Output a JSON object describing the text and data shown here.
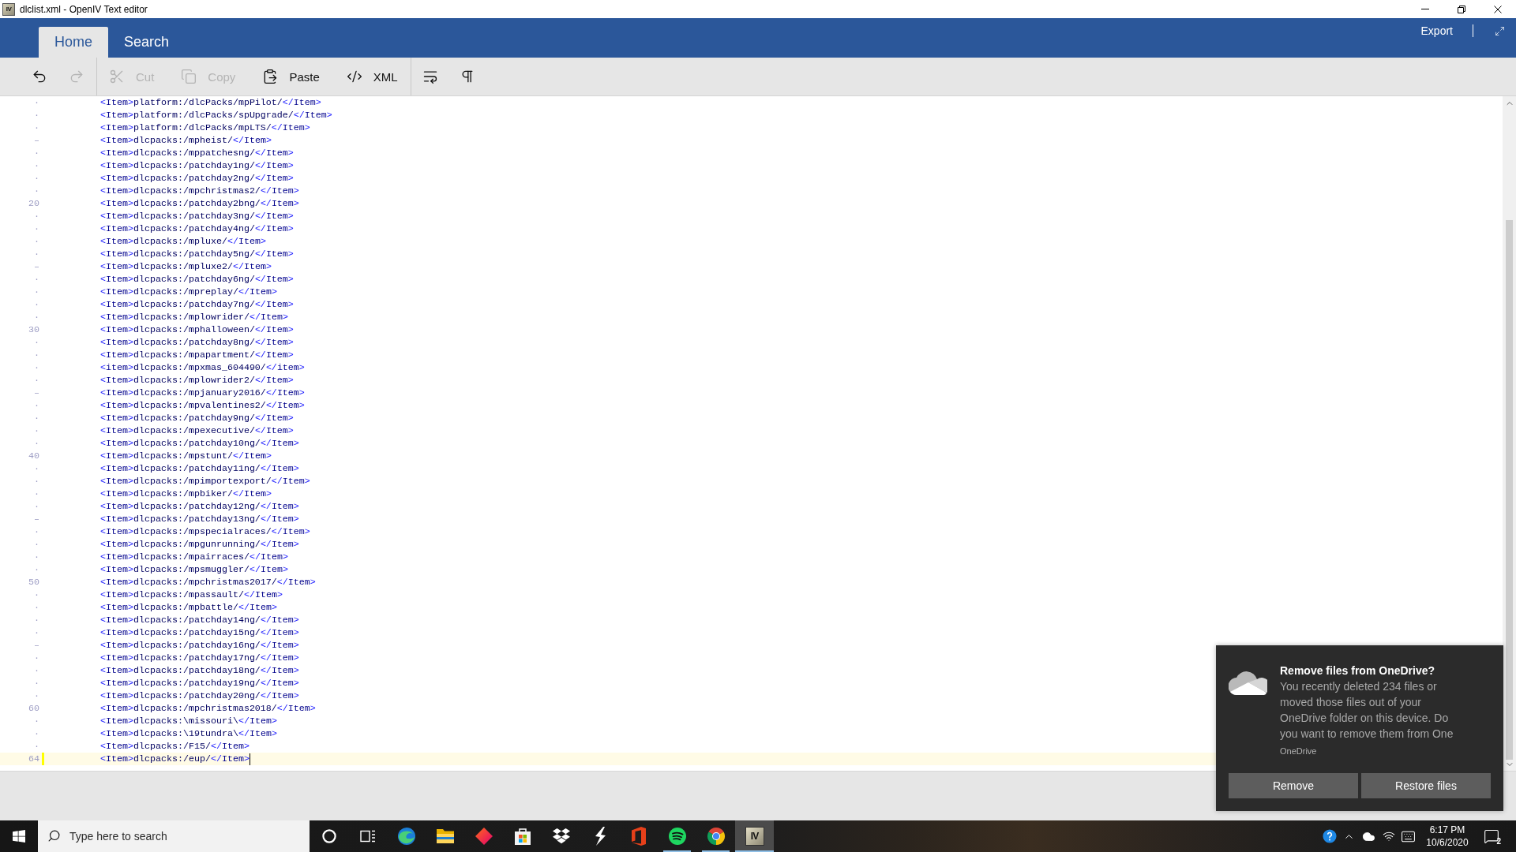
{
  "window": {
    "icon_text": "IV",
    "title": "dlclist.xml - OpenIV Text editor"
  },
  "ribbon": {
    "tabs": [
      {
        "label": "Home",
        "selected": true
      },
      {
        "label": "Search",
        "selected": false
      }
    ],
    "actions": [
      "Export"
    ]
  },
  "toolbar": {
    "groups": [
      [
        {
          "kind": "undo",
          "disabled": false
        },
        {
          "kind": "redo",
          "disabled": true
        }
      ],
      [
        {
          "kind": "cut",
          "label": "Cut",
          "disabled": true
        },
        {
          "kind": "copy",
          "label": "Copy",
          "disabled": true
        },
        {
          "kind": "paste",
          "label": "Paste",
          "disabled": false
        },
        {
          "kind": "xml",
          "label": "XML",
          "disabled": false
        }
      ],
      [
        {
          "kind": "wrap",
          "disabled": false
        },
        {
          "kind": "pilcrow",
          "disabled": false
        }
      ]
    ]
  },
  "editor": {
    "lines": [
      {
        "number": "·",
        "current": false,
        "code": "<Item>platform:/dlcPacks/mpPilot/</Item>"
      },
      {
        "number": "·",
        "current": false,
        "code": "<Item>platform:/dlcPacks/spUpgrade/</Item>"
      },
      {
        "number": "·",
        "current": false,
        "code": "<Item>platform:/dlcPacks/mpLTS/</Item>"
      },
      {
        "number": "–",
        "current": false,
        "code": "<Item>dlcpacks:/mpheist/</Item>"
      },
      {
        "number": "·",
        "current": false,
        "code": "<Item>dlcpacks:/mppatchesng/</Item>"
      },
      {
        "number": "·",
        "current": false,
        "code": "<Item>dlcpacks:/patchday1ng/</Item>"
      },
      {
        "number": "·",
        "current": false,
        "code": "<Item>dlcpacks:/patchday2ng/</Item>"
      },
      {
        "number": "·",
        "current": false,
        "code": "<Item>dlcpacks:/mpchristmas2/</Item>"
      },
      {
        "number": "20",
        "current": false,
        "code": "<Item>dlcpacks:/patchday2bng/</Item>"
      },
      {
        "number": "·",
        "current": false,
        "code": "<Item>dlcpacks:/patchday3ng/</Item>"
      },
      {
        "number": "·",
        "current": false,
        "code": "<Item>dlcpacks:/patchday4ng/</Item>"
      },
      {
        "number": "·",
        "current": false,
        "code": "<Item>dlcpacks:/mpluxe/</Item>"
      },
      {
        "number": "·",
        "current": false,
        "code": "<Item>dlcpacks:/patchday5ng/</Item>"
      },
      {
        "number": "–",
        "current": false,
        "code": "<Item>dlcpacks:/mpluxe2/</Item>"
      },
      {
        "number": "·",
        "current": false,
        "code": "<Item>dlcpacks:/patchday6ng/</Item>"
      },
      {
        "number": "·",
        "current": false,
        "code": "<Item>dlcpacks:/mpreplay/</Item>"
      },
      {
        "number": "·",
        "current": false,
        "code": "<Item>dlcpacks:/patchday7ng/</Item>"
      },
      {
        "number": "·",
        "current": false,
        "code": "<Item>dlcpacks:/mplowrider/</Item>"
      },
      {
        "number": "30",
        "current": false,
        "code": "<Item>dlcpacks:/mphalloween/</Item>"
      },
      {
        "number": "·",
        "current": false,
        "code": "<Item>dlcpacks:/patchday8ng/</Item>"
      },
      {
        "number": "·",
        "current": false,
        "code": "<Item>dlcpacks:/mpapartment/</Item>"
      },
      {
        "number": "·",
        "current": false,
        "code": "<item>dlcpacks:/mpxmas_604490/</item>"
      },
      {
        "number": "·",
        "current": false,
        "code": "<Item>dlcpacks:/mplowrider2/</Item>"
      },
      {
        "number": "–",
        "current": false,
        "code": "<Item>dlcpacks:/mpjanuary2016/</Item>"
      },
      {
        "number": "·",
        "current": false,
        "code": "<Item>dlcpacks:/mpvalentines2/</Item>"
      },
      {
        "number": "·",
        "current": false,
        "code": "<Item>dlcpacks:/patchday9ng/</Item>"
      },
      {
        "number": "·",
        "current": false,
        "code": "<Item>dlcpacks:/mpexecutive/</Item>"
      },
      {
        "number": "·",
        "current": false,
        "code": "<Item>dlcpacks:/patchday10ng/</Item>"
      },
      {
        "number": "40",
        "current": false,
        "code": "<Item>dlcpacks:/mpstunt/</Item>"
      },
      {
        "number": "·",
        "current": false,
        "code": "<Item>dlcpacks:/patchday11ng/</Item>"
      },
      {
        "number": "·",
        "current": false,
        "code": "<Item>dlcpacks:/mpimportexport/</Item>"
      },
      {
        "number": "·",
        "current": false,
        "code": "<Item>dlcpacks:/mpbiker/</Item>"
      },
      {
        "number": "·",
        "current": false,
        "code": "<Item>dlcpacks:/patchday12ng/</Item>"
      },
      {
        "number": "–",
        "current": false,
        "code": "<Item>dlcpacks:/patchday13ng/</Item>"
      },
      {
        "number": "·",
        "current": false,
        "code": "<Item>dlcpacks:/mpspecialraces/</Item>"
      },
      {
        "number": "·",
        "current": false,
        "code": "<Item>dlcpacks:/mpgunrunning/</Item>"
      },
      {
        "number": "·",
        "current": false,
        "code": "<Item>dlcpacks:/mpairraces/</Item>"
      },
      {
        "number": "·",
        "current": false,
        "code": "<Item>dlcpacks:/mpsmuggler/</Item>"
      },
      {
        "number": "50",
        "current": false,
        "code": "<Item>dlcpacks:/mpchristmas2017/</Item>"
      },
      {
        "number": "·",
        "current": false,
        "code": "<Item>dlcpacks:/mpassault/</Item>"
      },
      {
        "number": "·",
        "current": false,
        "code": "<Item>dlcpacks:/mpbattle/</Item>"
      },
      {
        "number": "·",
        "current": false,
        "code": "<Item>dlcpacks:/patchday14ng/</Item>"
      },
      {
        "number": "·",
        "current": false,
        "code": "<Item>dlcpacks:/patchday15ng/</Item>"
      },
      {
        "number": "–",
        "current": false,
        "code": "<Item>dlcpacks:/patchday16ng/</Item>"
      },
      {
        "number": "·",
        "current": false,
        "code": "<Item>dlcpacks:/patchday17ng/</Item>"
      },
      {
        "number": "·",
        "current": false,
        "code": "<Item>dlcpacks:/patchday18ng/</Item>"
      },
      {
        "number": "·",
        "current": false,
        "code": "<Item>dlcpacks:/patchday19ng/</Item>"
      },
      {
        "number": "·",
        "current": false,
        "code": "<Item>dlcpacks:/patchday20ng/</Item>"
      },
      {
        "number": "60",
        "current": false,
        "code": "<Item>dlcpacks:/mpchristmas2018/</Item>"
      },
      {
        "number": "·",
        "current": false,
        "code": "<Item>dlcpacks:\\missouri\\</Item>"
      },
      {
        "number": "·",
        "current": false,
        "code": "<Item>dlcpacks:\\19tundra\\</Item>"
      },
      {
        "number": "·",
        "current": false,
        "code": "<Item>dlcpacks:/F15/</Item>"
      },
      {
        "number": "64",
        "current": true,
        "code": "<Item>dlcpacks:/eup/</Item>"
      }
    ]
  },
  "notification": {
    "title": "Remove files from OneDrive?",
    "body": "You recently deleted 234 files or moved those files out of your OneDrive folder on this device. Do you want to remove them from One",
    "source": "OneDrive",
    "buttons": [
      "Remove",
      "Restore files"
    ]
  },
  "taskbar": {
    "search": {
      "placeholder": "Type here to search"
    },
    "apps": [
      {
        "kind": "cortana",
        "running": false,
        "active": false
      },
      {
        "kind": "taskview",
        "running": false,
        "active": false
      },
      {
        "kind": "edge",
        "running": false,
        "active": false
      },
      {
        "kind": "explorer",
        "running": false,
        "active": false
      },
      {
        "kind": "diamond",
        "running": false,
        "active": false
      },
      {
        "kind": "store",
        "running": false,
        "active": false
      },
      {
        "kind": "dropbox",
        "running": false,
        "active": false
      },
      {
        "kind": "bolt",
        "running": false,
        "active": false
      },
      {
        "kind": "office",
        "running": false,
        "active": false
      },
      {
        "kind": "spotify",
        "running": true,
        "active": false
      },
      {
        "kind": "chrome",
        "running": true,
        "active": false
      },
      {
        "kind": "openiv",
        "icon_text": "IV",
        "running": true,
        "active": true
      }
    ],
    "tray": {
      "icons": [
        {
          "kind": "help"
        },
        {
          "kind": "chevron"
        },
        {
          "kind": "cloud"
        },
        {
          "kind": "wifi"
        },
        {
          "kind": "keyboard"
        }
      ],
      "time": "6:17 PM",
      "date": "10/6/2020",
      "notifications": "2"
    }
  }
}
